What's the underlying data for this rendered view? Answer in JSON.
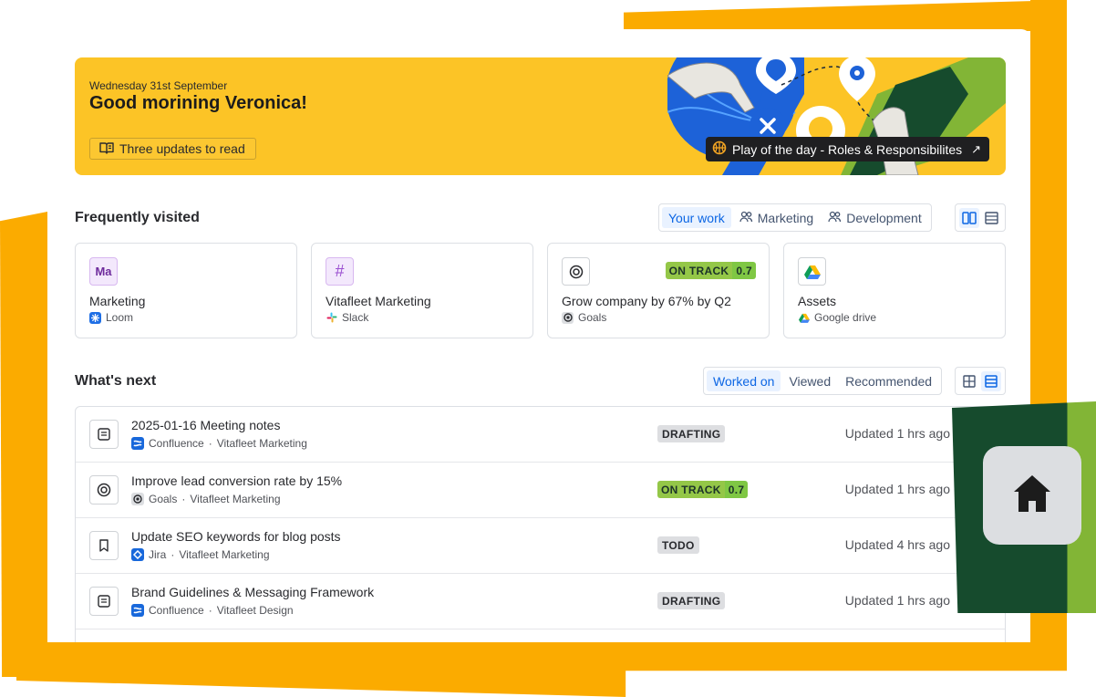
{
  "colors": {
    "frame_orange": "#fbab00",
    "banner_yellow": "#fcc426",
    "dark_green": "#164b2d",
    "lime_green": "#82b536",
    "accent_blue": "#0c66e4"
  },
  "banner": {
    "date": "Wednesday 31st September",
    "greeting": "Good morining Veronica!",
    "updates_label": "Three updates to read",
    "play_label": "Play of the day - Roles & Responsibilites",
    "play_arrow": "↗"
  },
  "frequently_visited": {
    "title": "Frequently visited",
    "tabs": [
      {
        "label": "Your work",
        "active": true
      },
      {
        "label": "Marketing",
        "active": false
      },
      {
        "label": "Development",
        "active": false
      }
    ],
    "cards": [
      {
        "icon_text": "Ma",
        "title": "Marketing",
        "source": "Loom",
        "source_icon": "loom-icon"
      },
      {
        "icon_text": "#",
        "title": "Vitafleet Marketing",
        "source": "Slack",
        "source_icon": "slack-icon"
      },
      {
        "icon": "target-icon",
        "title": "Grow company by 67% by Q2",
        "source": "Goals",
        "source_icon": "goals-icon",
        "status": "ON TRACK",
        "score": "0.7"
      },
      {
        "icon": "google-drive-icon",
        "title": "Assets",
        "source": "Google drive",
        "source_icon": "google-drive-icon"
      }
    ]
  },
  "whats_next": {
    "title": "What's next",
    "tabs": [
      {
        "label": "Worked on",
        "active": true
      },
      {
        "label": "Viewed",
        "active": false
      },
      {
        "label": "Recommended",
        "active": false
      }
    ],
    "rows": [
      {
        "icon": "page-icon",
        "title": "2025-01-16 Meeting notes",
        "app": "Confluence",
        "space": "Vitafleet Marketing",
        "status": "DRAFTING",
        "updated": "Updated 1 hrs ago"
      },
      {
        "icon": "target-icon",
        "title": "Improve lead conversion rate by 15%",
        "app": "Goals",
        "space": "Vitafleet Marketing",
        "status": "ON TRACK",
        "score": "0.7",
        "updated": "Updated 1 hrs ago"
      },
      {
        "icon": "bookmark-icon",
        "title": "Update SEO keywords for blog posts",
        "app": "Jira",
        "space": "Vitafleet Marketing",
        "status": "TODO",
        "updated": "Updated 4 hrs ago"
      },
      {
        "icon": "page-icon",
        "title": "Brand Guidelines & Messaging Framework",
        "app": "Confluence",
        "space": "Vitafleet Design",
        "status": "DRAFTING",
        "updated": "Updated 1 hrs ago"
      }
    ],
    "separator": "·"
  },
  "home_button_icon": "home-icon"
}
